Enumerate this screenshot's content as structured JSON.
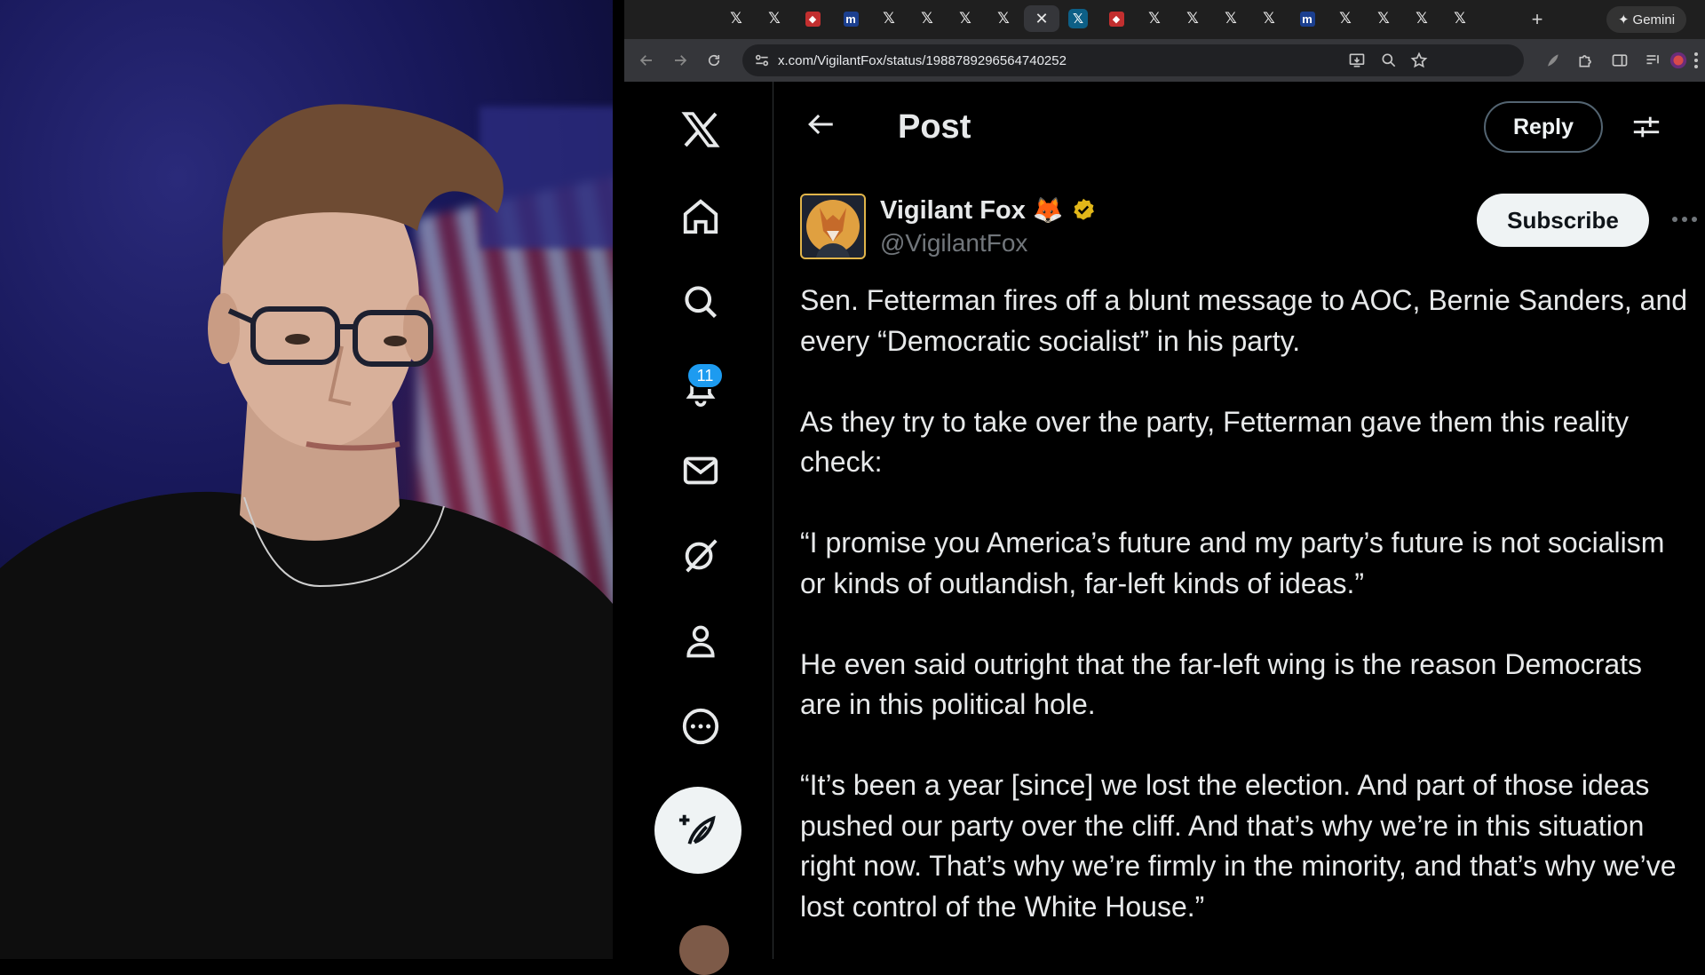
{
  "browser": {
    "tabs": [
      {
        "icon": "x-favicon"
      },
      {
        "icon": "x-favicon"
      },
      {
        "icon": "red-news-favicon"
      },
      {
        "icon": "m-favicon"
      },
      {
        "icon": "x-favicon"
      },
      {
        "icon": "x-favicon"
      },
      {
        "icon": "x-favicon"
      },
      {
        "icon": "x-favicon"
      },
      {
        "icon": "close-icon",
        "active": true
      },
      {
        "icon": "x-highlight-favicon"
      },
      {
        "icon": "red-news-favicon"
      },
      {
        "icon": "x-favicon"
      },
      {
        "icon": "x-favicon"
      },
      {
        "icon": "x-favicon"
      },
      {
        "icon": "x-favicon"
      },
      {
        "icon": "m-favicon"
      },
      {
        "icon": "x-favicon"
      },
      {
        "icon": "x-favicon"
      },
      {
        "icon": "x-favicon"
      },
      {
        "icon": "x-favicon"
      }
    ],
    "new_tab_label": "+",
    "gemini_label": "Gemini",
    "url": "x.com/VigilantFox/status/1988789296564740252"
  },
  "x": {
    "nav": {
      "notifications_badge": "11"
    },
    "header": {
      "title": "Post",
      "reply_label": "Reply"
    },
    "post": {
      "author_name": "Vigilant Fox",
      "author_emoji": "🦊",
      "author_handle": "@VigilantFox",
      "subscribe_label": "Subscribe",
      "paragraphs": [
        "Sen. Fetterman fires off a blunt message to AOC, Bernie Sanders, and every “Democratic socialist” in his party.",
        "As they try to take over the party, Fetterman gave them this reality check:",
        "“I promise you America’s future and my party’s future is not socialism or kinds of outlandish, far-left kinds of ideas.”",
        "He even said outright that the far-left wing is the reason Democrats are in this political hole.",
        "“It’s been a year [since] we lost the election. And part of those ideas pushed our party over the cliff. And that’s why we’re in this situation right now. That’s why we’re firmly in the minority, and that’s why we’ve lost control of the White House.”"
      ]
    }
  },
  "colors": {
    "accent_blue": "#1d9bf0",
    "verified_gold": "#e2b719",
    "text_primary": "#e7e9ea",
    "text_secondary": "#71767b"
  }
}
